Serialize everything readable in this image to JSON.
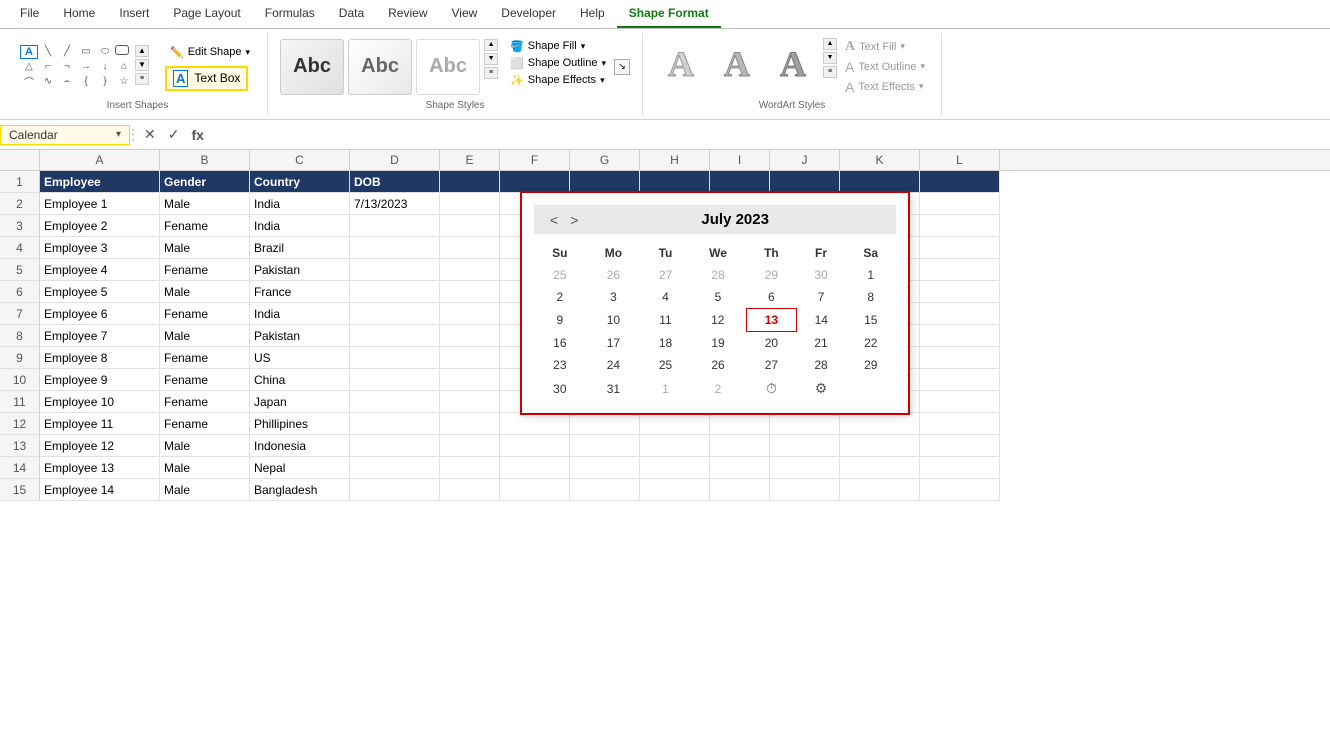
{
  "ribbon": {
    "tabs": [
      {
        "label": "File",
        "active": false
      },
      {
        "label": "Home",
        "active": false
      },
      {
        "label": "Insert",
        "active": false
      },
      {
        "label": "Page Layout",
        "active": false
      },
      {
        "label": "Formulas",
        "active": false
      },
      {
        "label": "Data",
        "active": false
      },
      {
        "label": "Review",
        "active": false
      },
      {
        "label": "View",
        "active": false
      },
      {
        "label": "Developer",
        "active": false
      },
      {
        "label": "Help",
        "active": false
      },
      {
        "label": "Shape Format",
        "active": true
      }
    ],
    "groups": {
      "insert_shapes_label": "Insert Shapes",
      "shape_styles_label": "Shape Styles",
      "wordart_label": "WordArt Styles",
      "edit_shape_label": "Edit Shape",
      "text_box_label": "Text Box",
      "shape_fill_label": "Shape Fill",
      "shape_outline_label": "Shape Outline",
      "shape_effects_label": "Shape Effects",
      "text_fill_label": "Text Fill",
      "text_outline_label": "Text Outline",
      "text_effects_label": "Text Effects"
    }
  },
  "formula_bar": {
    "name_box": "Calendar",
    "formula": ""
  },
  "columns": [
    "A",
    "B",
    "C",
    "D",
    "E",
    "F",
    "G",
    "H",
    "I",
    "J",
    "K",
    "L"
  ],
  "headers": [
    "Employee",
    "Gender",
    "Country",
    "DOB",
    "",
    "",
    "",
    "",
    "",
    "",
    "",
    ""
  ],
  "rows": [
    [
      "Employee 1",
      "Male",
      "India",
      "7/13/2023"
    ],
    [
      "Employee 2",
      "Fename",
      "India",
      ""
    ],
    [
      "Employee 3",
      "Male",
      "Brazil",
      ""
    ],
    [
      "Employee 4",
      "Fename",
      "Pakistan",
      ""
    ],
    [
      "Employee 5",
      "Male",
      "France",
      ""
    ],
    [
      "Employee 6",
      "Fename",
      "India",
      ""
    ],
    [
      "Employee 7",
      "Male",
      "Pakistan",
      ""
    ],
    [
      "Employee 8",
      "Fename",
      "US",
      ""
    ],
    [
      "Employee 9",
      "Fename",
      "China",
      ""
    ],
    [
      "Employee 10",
      "Fename",
      "Japan",
      ""
    ],
    [
      "Employee 11",
      "Fename",
      "Phillipines",
      ""
    ],
    [
      "Employee 12",
      "Male",
      "Indonesia",
      ""
    ],
    [
      "Employee 13",
      "Male",
      "Nepal",
      ""
    ],
    [
      "Employee 14",
      "Male",
      "Bangladesh",
      ""
    ]
  ],
  "calendar": {
    "title": "July 2023",
    "prev_btn": "<",
    "next_btn": ">",
    "day_headers": [
      "Su",
      "Mo",
      "Tu",
      "We",
      "Th",
      "Fr",
      "Sa"
    ],
    "weeks": [
      [
        "25",
        "26",
        "27",
        "28",
        "29",
        "30",
        "1"
      ],
      [
        "2",
        "3",
        "4",
        "5",
        "6",
        "7",
        "8"
      ],
      [
        "9",
        "10",
        "11",
        "12",
        "13",
        "14",
        "15"
      ],
      [
        "16",
        "17",
        "18",
        "19",
        "20",
        "21",
        "22"
      ],
      [
        "23",
        "24",
        "25",
        "26",
        "27",
        "28",
        "29"
      ],
      [
        "30",
        "31",
        "1",
        "2",
        "⏱",
        "⚙",
        ""
      ]
    ],
    "today": "13",
    "prev_month_days": [
      "25",
      "26",
      "27",
      "28",
      "29",
      "30"
    ],
    "next_month_days": [
      "1",
      "2"
    ]
  }
}
